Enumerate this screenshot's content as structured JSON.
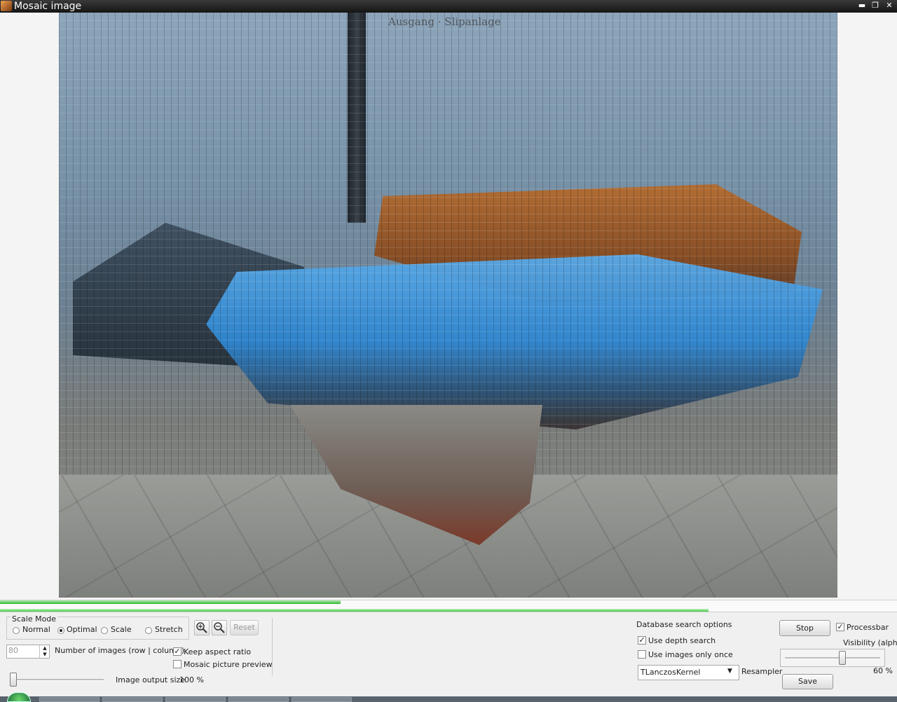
{
  "window": {
    "title": "Mosaic image",
    "buttons": [
      "▬",
      "❐",
      "✕"
    ]
  },
  "viewport": {
    "caption": "Ausgang · Slipanlage"
  },
  "progress": {
    "overall": 0.38,
    "current": 0.79
  },
  "scale_mode": {
    "legend": "Scale Mode",
    "options": [
      {
        "label": "Normal",
        "selected": false
      },
      {
        "label": "Optimal",
        "selected": true
      },
      {
        "label": "Scale",
        "selected": false
      },
      {
        "label": "Stretch",
        "selected": false
      }
    ],
    "zoom_in_icon": "zoom-in-icon",
    "zoom_out_icon": "zoom-out-icon",
    "reset_label": "Reset"
  },
  "grid": {
    "count_value": "80",
    "count_label": "Number of images (row | column)",
    "keep_aspect_label": "Keep aspect ratio",
    "keep_aspect_checked": true,
    "preview_label": "Mosaic picture preview",
    "preview_checked": false
  },
  "output": {
    "size_label": "Image output size",
    "size_value": "100 %",
    "size_level": 0
  },
  "database": {
    "title": "Database search options",
    "depth_label": "Use depth search",
    "depth_checked": true,
    "once_label": "Use images only once",
    "once_checked": false,
    "resampler_value": "TLanczosKernel",
    "resampler_label": "Resampler"
  },
  "actions": {
    "stop_label": "Stop",
    "processbar_label": "Processbar",
    "processbar_checked": true,
    "visibility_label": "Visibility (alpha)",
    "visibility_value": "60 %",
    "visibility_level": 0.6,
    "save_label": "Save"
  },
  "colors": {
    "progress": "#28b828",
    "titlebar": "#1e1e1e"
  }
}
